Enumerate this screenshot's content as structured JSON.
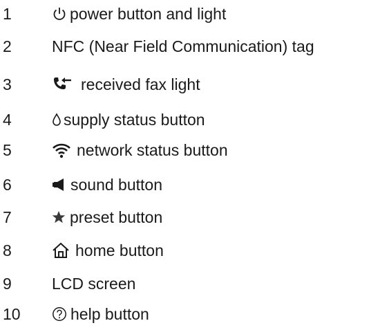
{
  "legend": {
    "items": [
      {
        "number": "1",
        "icon": "power-icon",
        "label": "power button and light"
      },
      {
        "number": "2",
        "icon": "",
        "label": "NFC (Near Field Communication) tag"
      },
      {
        "number": "3",
        "icon": "received-fax-icon",
        "label": "received fax light"
      },
      {
        "number": "4",
        "icon": "ink-drop-icon",
        "label": "supply status button"
      },
      {
        "number": "5",
        "icon": "wifi-icon",
        "label": "network status button"
      },
      {
        "number": "6",
        "icon": "speaker-icon",
        "label": "sound button"
      },
      {
        "number": "7",
        "icon": "star-icon",
        "label": "preset button"
      },
      {
        "number": "8",
        "icon": "home-icon",
        "label": "home button"
      },
      {
        "number": "9",
        "icon": "",
        "label": "LCD screen"
      },
      {
        "number": "10",
        "icon": "help-icon",
        "label": "help button"
      }
    ]
  }
}
